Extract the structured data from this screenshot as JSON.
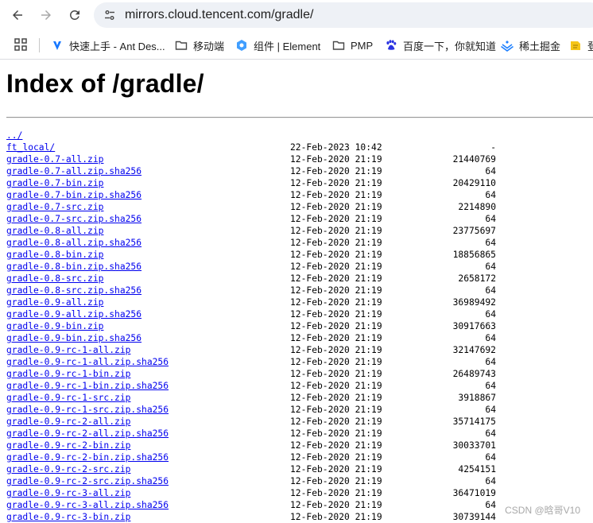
{
  "browser": {
    "url_host": "mirrors.cloud.tencent.com",
    "url_path": "/gradle/",
    "bookmarks": [
      {
        "label": "快速上手 - Ant Des...",
        "icon": "ant-design-icon"
      },
      {
        "label": "移动端",
        "icon": "folder-icon"
      },
      {
        "label": "组件 | Element",
        "icon": "element-icon"
      },
      {
        "label": "PMP",
        "icon": "folder-icon"
      },
      {
        "label": "百度一下，你就知道",
        "icon": "baidu-icon"
      },
      {
        "label": "稀土掘金",
        "icon": "juejin-icon"
      },
      {
        "label": "登",
        "icon": "note-icon"
      }
    ]
  },
  "page": {
    "title": "Index of /gradle/",
    "entries": [
      {
        "name": "../",
        "date": "",
        "size": ""
      },
      {
        "name": "ft_local/",
        "date": "22-Feb-2023 10:42",
        "size": "-"
      },
      {
        "name": "gradle-0.7-all.zip",
        "date": "12-Feb-2020 21:19",
        "size": "21440769"
      },
      {
        "name": "gradle-0.7-all.zip.sha256",
        "date": "12-Feb-2020 21:19",
        "size": "64"
      },
      {
        "name": "gradle-0.7-bin.zip",
        "date": "12-Feb-2020 21:19",
        "size": "20429110"
      },
      {
        "name": "gradle-0.7-bin.zip.sha256",
        "date": "12-Feb-2020 21:19",
        "size": "64"
      },
      {
        "name": "gradle-0.7-src.zip",
        "date": "12-Feb-2020 21:19",
        "size": "2214890"
      },
      {
        "name": "gradle-0.7-src.zip.sha256",
        "date": "12-Feb-2020 21:19",
        "size": "64"
      },
      {
        "name": "gradle-0.8-all.zip",
        "date": "12-Feb-2020 21:19",
        "size": "23775697"
      },
      {
        "name": "gradle-0.8-all.zip.sha256",
        "date": "12-Feb-2020 21:19",
        "size": "64"
      },
      {
        "name": "gradle-0.8-bin.zip",
        "date": "12-Feb-2020 21:19",
        "size": "18856865"
      },
      {
        "name": "gradle-0.8-bin.zip.sha256",
        "date": "12-Feb-2020 21:19",
        "size": "64"
      },
      {
        "name": "gradle-0.8-src.zip",
        "date": "12-Feb-2020 21:19",
        "size": "2658172"
      },
      {
        "name": "gradle-0.8-src.zip.sha256",
        "date": "12-Feb-2020 21:19",
        "size": "64"
      },
      {
        "name": "gradle-0.9-all.zip",
        "date": "12-Feb-2020 21:19",
        "size": "36989492"
      },
      {
        "name": "gradle-0.9-all.zip.sha256",
        "date": "12-Feb-2020 21:19",
        "size": "64"
      },
      {
        "name": "gradle-0.9-bin.zip",
        "date": "12-Feb-2020 21:19",
        "size": "30917663"
      },
      {
        "name": "gradle-0.9-bin.zip.sha256",
        "date": "12-Feb-2020 21:19",
        "size": "64"
      },
      {
        "name": "gradle-0.9-rc-1-all.zip",
        "date": "12-Feb-2020 21:19",
        "size": "32147692"
      },
      {
        "name": "gradle-0.9-rc-1-all.zip.sha256",
        "date": "12-Feb-2020 21:19",
        "size": "64"
      },
      {
        "name": "gradle-0.9-rc-1-bin.zip",
        "date": "12-Feb-2020 21:19",
        "size": "26489743"
      },
      {
        "name": "gradle-0.9-rc-1-bin.zip.sha256",
        "date": "12-Feb-2020 21:19",
        "size": "64"
      },
      {
        "name": "gradle-0.9-rc-1-src.zip",
        "date": "12-Feb-2020 21:19",
        "size": "3918867"
      },
      {
        "name": "gradle-0.9-rc-1-src.zip.sha256",
        "date": "12-Feb-2020 21:19",
        "size": "64"
      },
      {
        "name": "gradle-0.9-rc-2-all.zip",
        "date": "12-Feb-2020 21:19",
        "size": "35714175"
      },
      {
        "name": "gradle-0.9-rc-2-all.zip.sha256",
        "date": "12-Feb-2020 21:19",
        "size": "64"
      },
      {
        "name": "gradle-0.9-rc-2-bin.zip",
        "date": "12-Feb-2020 21:19",
        "size": "30033701"
      },
      {
        "name": "gradle-0.9-rc-2-bin.zip.sha256",
        "date": "12-Feb-2020 21:19",
        "size": "64"
      },
      {
        "name": "gradle-0.9-rc-2-src.zip",
        "date": "12-Feb-2020 21:19",
        "size": "4254151"
      },
      {
        "name": "gradle-0.9-rc-2-src.zip.sha256",
        "date": "12-Feb-2020 21:19",
        "size": "64"
      },
      {
        "name": "gradle-0.9-rc-3-all.zip",
        "date": "12-Feb-2020 21:19",
        "size": "36471019"
      },
      {
        "name": "gradle-0.9-rc-3-all.zip.sha256",
        "date": "12-Feb-2020 21:19",
        "size": "64"
      },
      {
        "name": "gradle-0.9-rc-3-bin.zip",
        "date": "12-Feb-2020 21:19",
        "size": "30739144"
      }
    ]
  },
  "watermark": "CSDN @晗哥V10"
}
